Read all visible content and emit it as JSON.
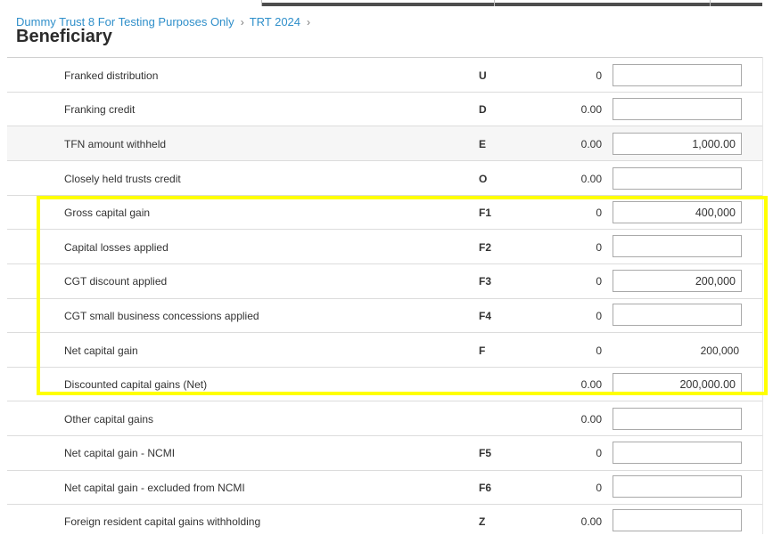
{
  "breadcrumb": {
    "items": [
      "Dummy Trust 8 For Testing Purposes Only",
      "TRT 2024"
    ],
    "separator": "›"
  },
  "page": {
    "title": "Beneficiary"
  },
  "rows": [
    {
      "label": "Franked distribution",
      "code": "U",
      "prev": "0",
      "input": ""
    },
    {
      "label": "Franking credit",
      "code": "D",
      "prev": "0.00",
      "input": ""
    },
    {
      "label": "TFN amount withheld",
      "code": "E",
      "prev": "0.00",
      "input": "1,000.00"
    },
    {
      "label": "Closely held trusts credit",
      "code": "O",
      "prev": "0.00",
      "input": ""
    },
    {
      "label": "Gross capital gain",
      "code": "F1",
      "prev": "0",
      "input": "400,000"
    },
    {
      "label": "Capital losses applied",
      "code": "F2",
      "prev": "0",
      "input": ""
    },
    {
      "label": "CGT discount applied",
      "code": "F3",
      "prev": "0",
      "input": "200,000"
    },
    {
      "label": "CGT small business concessions applied",
      "code": "F4",
      "prev": "0",
      "input": ""
    },
    {
      "label": "Net capital gain",
      "code": "F",
      "prev": "0",
      "value": "200,000"
    },
    {
      "label": "Discounted capital gains (Net)",
      "code": "",
      "prev": "0.00",
      "input": "200,000.00"
    },
    {
      "label": "Other capital gains",
      "code": "",
      "prev": "0.00",
      "input": ""
    },
    {
      "label": "Net capital gain - NCMI",
      "code": "F5",
      "prev": "0",
      "input": ""
    },
    {
      "label": "Net capital gain - excluded from NCMI",
      "code": "F6",
      "prev": "0",
      "input": ""
    },
    {
      "label": "Foreign resident capital gains withholding",
      "code": "Z",
      "prev": "0.00",
      "input": ""
    }
  ],
  "colors": {
    "link": "#2f8fca",
    "highlight": "#ffff00",
    "shaded_row": "#f6f6f6"
  }
}
